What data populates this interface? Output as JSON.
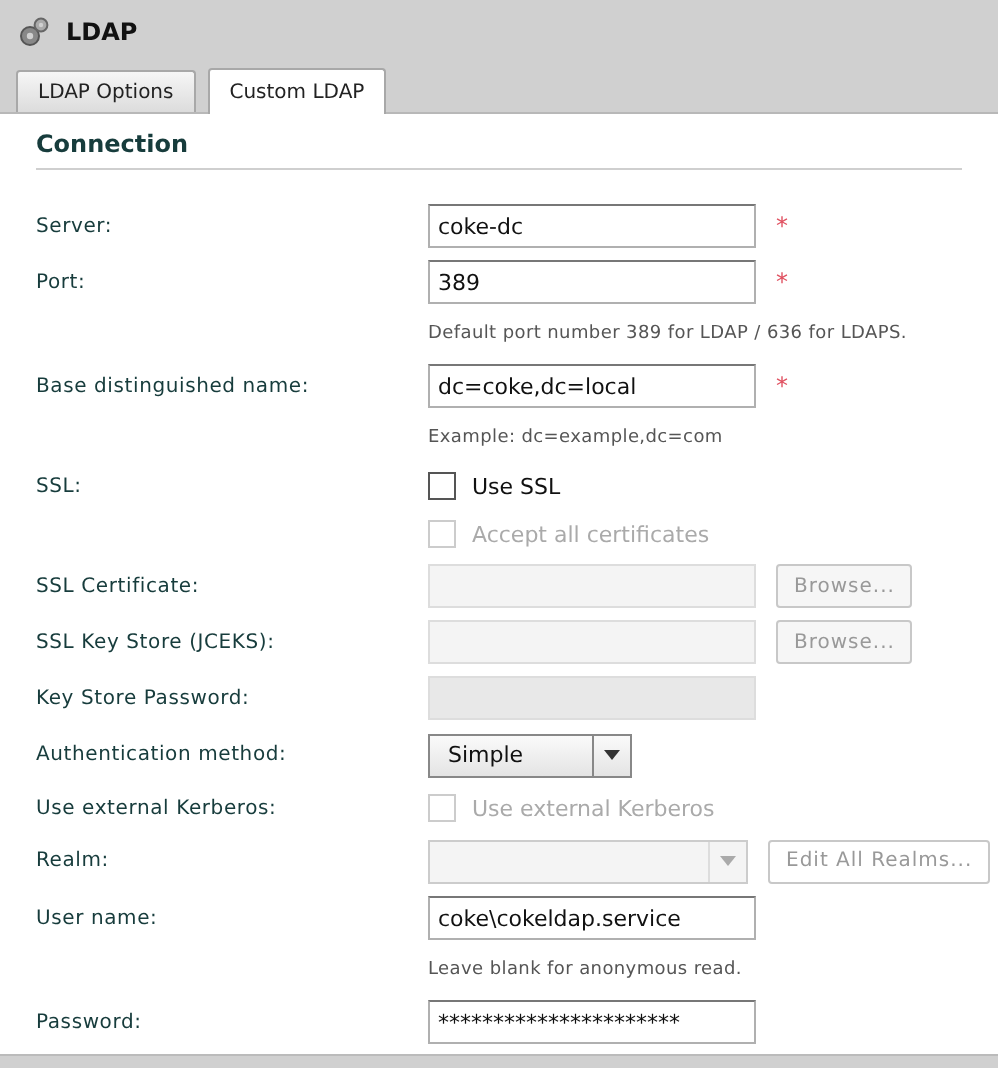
{
  "header": {
    "title": "LDAP"
  },
  "tabs": [
    {
      "label": "LDAP Options",
      "selected": false
    },
    {
      "label": "Custom LDAP",
      "selected": true
    }
  ],
  "section": {
    "title": "Connection"
  },
  "rows": [
    {
      "kind": "text",
      "label": "Server:",
      "value": "coke-dc",
      "mark": "*",
      "disabled": false
    },
    {
      "kind": "text",
      "label": "Port:",
      "value": "389",
      "mark": "*",
      "disabled": false
    },
    {
      "kind": "hint",
      "text": "Default port number 389 for LDAP / 636 for LDAPS."
    },
    {
      "kind": "text",
      "label": "Base distinguished name:",
      "value": "dc=coke,dc=local",
      "mark": "*",
      "disabled": false
    },
    {
      "kind": "hint",
      "text": "Example: dc=example,dc=com"
    },
    {
      "kind": "checkbox",
      "label": "SSL:",
      "text": "Use SSL",
      "checked": false,
      "disabled": false
    },
    {
      "kind": "checkbox",
      "text": "Accept all certificates",
      "checked": false,
      "disabled": true
    },
    {
      "kind": "text",
      "label": "SSL Certificate:",
      "value": "",
      "disabled": true,
      "button": "Browse..."
    },
    {
      "kind": "text",
      "label": "SSL Key Store (JCEKS):",
      "value": "",
      "disabled": true,
      "button": "Browse..."
    },
    {
      "kind": "text",
      "label": "Key Store Password:",
      "value": "",
      "disabled": true
    },
    {
      "kind": "select",
      "label": "Authentication method:",
      "value": "Simple",
      "disabled": false
    },
    {
      "kind": "checkbox",
      "label": "Use external Kerberos:",
      "text": "Use external Kerberos",
      "checked": false,
      "disabled": true
    },
    {
      "kind": "select",
      "label": "Realm:",
      "value": "",
      "disabled": true,
      "button": "Edit All Realms..."
    },
    {
      "kind": "text",
      "label": "User name:",
      "value": "coke\\cokeldap.service",
      "disabled": false
    },
    {
      "kind": "hint",
      "text": "Leave blank for anonymous read."
    },
    {
      "kind": "text",
      "label": "Password:",
      "value": "**********************",
      "disabled": false
    }
  ]
}
